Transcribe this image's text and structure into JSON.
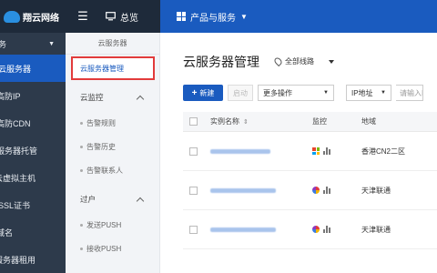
{
  "topbar": {
    "logo_text": "翔云网络",
    "menu_icon": "hamburger-icon",
    "overview_label": "总览",
    "products_label": "产品与服务"
  },
  "leftbar": {
    "head_label": "务",
    "items": [
      {
        "label": "云服务器",
        "active": true
      },
      {
        "label": "高防IP",
        "active": false
      },
      {
        "label": "高防CDN",
        "active": false
      },
      {
        "label": "服务器托管",
        "active": false
      },
      {
        "label": "云虚拟主机",
        "active": false
      },
      {
        "label": "SSL证书",
        "active": false
      },
      {
        "label": "域名",
        "active": false
      },
      {
        "label": "服务器租用",
        "active": false
      }
    ]
  },
  "subbar": {
    "title": "云服务器",
    "active_item": "云服务器管理",
    "groups": [
      {
        "label": "云监控",
        "items": [
          "告警规则",
          "告警历史",
          "告警联系人"
        ]
      },
      {
        "label": "过户",
        "items": [
          "发送PUSH",
          "接收PUSH"
        ]
      }
    ]
  },
  "main": {
    "title": "云服务器管理",
    "region_label": "全部线路",
    "toolbar": {
      "new_label": "新建",
      "start_label": "启动",
      "more_label": "更多操作",
      "ip_label": "IP地址",
      "search_placeholder": "请输入IP"
    },
    "table": {
      "headers": {
        "name": "实例名称",
        "monitor": "监控",
        "region": "地域"
      },
      "rows": [
        {
          "os": "windows",
          "region": "香港CN2二区"
        },
        {
          "os": "linux",
          "region": "天津联通"
        },
        {
          "os": "linux",
          "region": "天津联通"
        }
      ]
    }
  },
  "colors": {
    "topbar_bg": "#1e2a3a",
    "accent_blue": "#1a5bbf",
    "highlight_red": "#e23b3b",
    "sidebar_bg": "#2d3a4b"
  }
}
